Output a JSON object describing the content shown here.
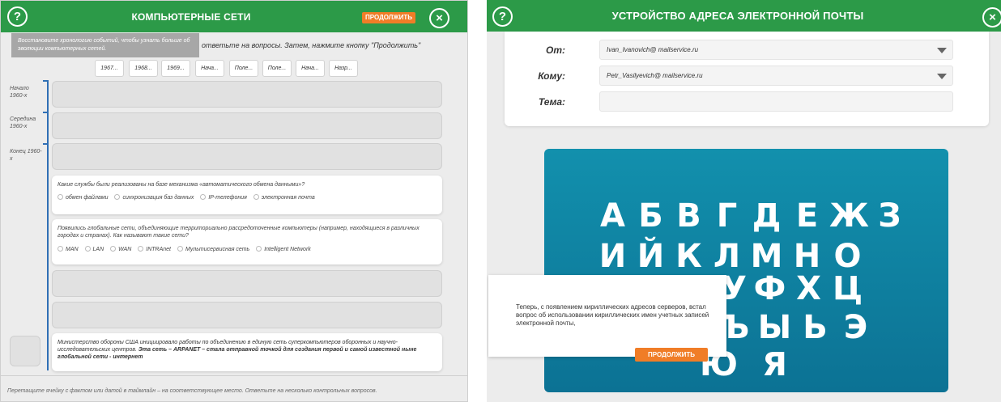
{
  "left": {
    "header": {
      "title": "Компьютерные сети",
      "continue": "Продолжить",
      "help": "?",
      "close": "×"
    },
    "tooltip": "Восстановите хронологию событий, чтобы узнать больше об эволюции компьютерных сетей.",
    "instruction": "ответьте на вопросы. Затем, нажмите кнопку \"Продолжить\"",
    "chips": [
      "1967...",
      "1968...",
      "1969...",
      "Нача...",
      "Поле...",
      "Поле...",
      "Нача...",
      "Назр..."
    ],
    "timeline_labels": [
      "Начало 1960-х",
      "Середина 1960-х",
      "Конец 1960-х"
    ],
    "q1": {
      "text": "Какие службы были реализованы на базе механизма «автоматического обмена данными»?",
      "options": [
        "обмен файлами",
        "синхронизация баз данных",
        "IP-телефония",
        "электронная почта"
      ]
    },
    "q2": {
      "text": "Появились глобальные сети, объединяющие территориально рассредоточенные компьютеры (например, находящиеся в различных городах и странах). Как называют такие сети?",
      "options": [
        "MAN",
        "LAN",
        "WAN",
        "INTRAnet",
        "Мультисервисная сеть",
        "Intelligent Network"
      ]
    },
    "fact": {
      "text": "Министерство обороны США инициировало работы по объединению в единую сеть суперкомпьютеров оборонных и научно-исследовательских центров.",
      "bold": "Эта сеть – ARPANET – стала отправной точкой для создания первой и самой известной ныне глобальной сети - интернет"
    },
    "footer": "Перетащите ячейку с фактом или датой в таймлайн – на соответствующее место. Ответьте на несколько контрольных вопросов."
  },
  "right": {
    "header": {
      "title": "Устройство адреса электронной почты",
      "help": "?"
    },
    "form": {
      "from_label": "От:",
      "from_value": "Ivan_Ivanovich@ mailservice.ru",
      "to_label": "Кому:",
      "to_value": "Petr_Vasilyevich@ mailservice.ru",
      "subject_label": "Тема:",
      "subject_value": ""
    },
    "letters": [
      "А",
      "Б",
      "В",
      "Г",
      "Д",
      "Е",
      "Ж",
      "З",
      "И",
      "Й",
      "К",
      "Л",
      "М",
      "Н",
      "О",
      "У",
      "Ф",
      "Х",
      "Ц",
      "Ъ",
      "Ы",
      "Ь",
      "Э",
      "Ю",
      "Я"
    ],
    "popup": {
      "text": "Теперь, с появлением кириллических адресов серверов, встал вопрос об использовании кириллических имен учетных записей электронной почты,",
      "button": "Продолжить"
    }
  }
}
